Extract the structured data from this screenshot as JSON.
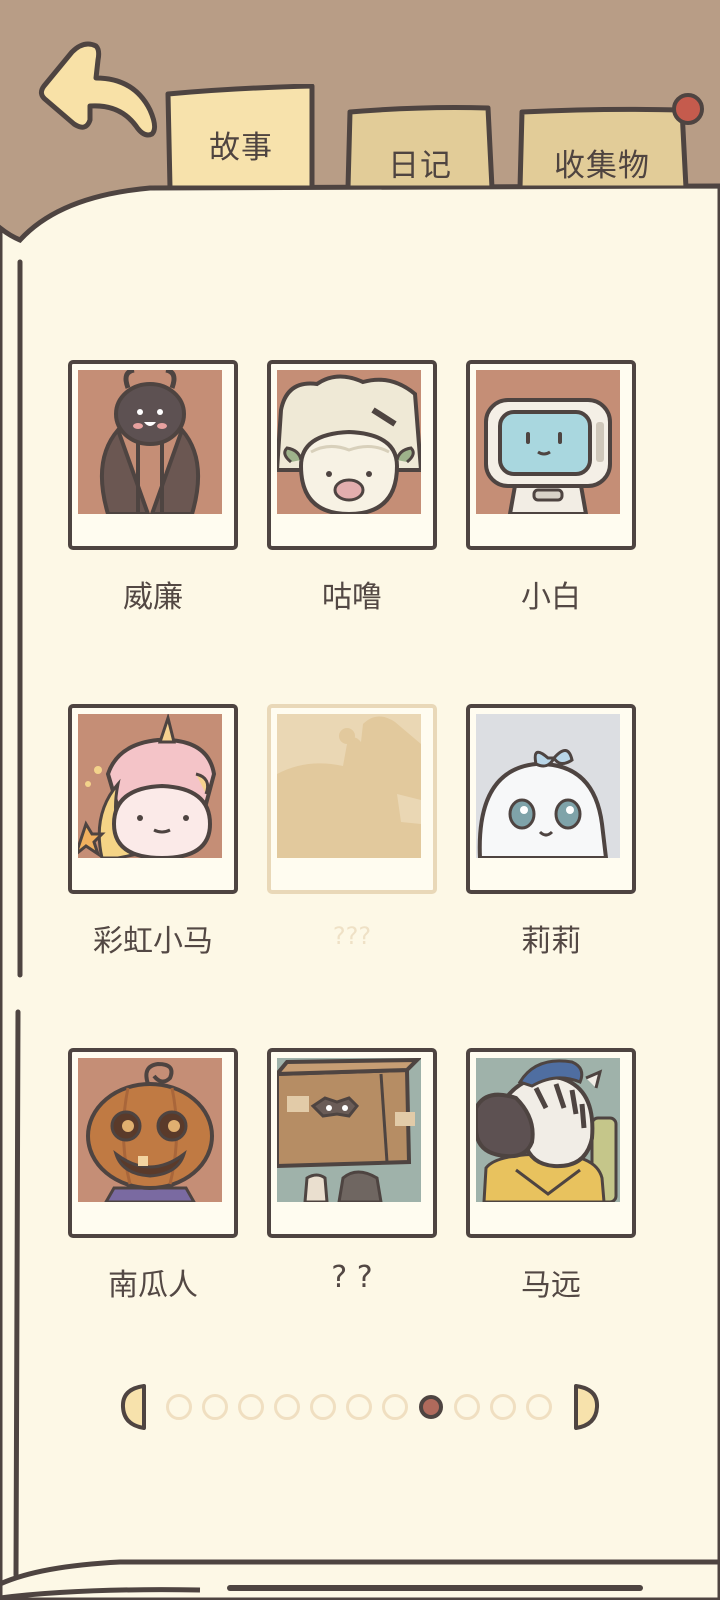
{
  "header": {
    "back_button": "back-arrow-icon",
    "tabs": [
      {
        "label": "故事",
        "active": true
      },
      {
        "label": "日记",
        "active": false
      },
      {
        "label": "收集物",
        "active": false,
        "has_notification": true
      }
    ]
  },
  "characters": [
    {
      "name": "威廉",
      "unlocked": true,
      "art": "beetle-character",
      "bg_color": "#c58e76"
    },
    {
      "name": "咕噜",
      "unlocked": true,
      "art": "sheep-pig-character",
      "bg_color": "#c58e76"
    },
    {
      "name": "小白",
      "unlocked": true,
      "art": "robot-character",
      "bg_color": "#c58e76"
    },
    {
      "name": "彩虹小马",
      "unlocked": true,
      "art": "unicorn-character",
      "bg_color": "#c58e76"
    },
    {
      "name": "???",
      "unlocked": false,
      "art": "locked-silhouette",
      "bg_color": "#ead7b4"
    },
    {
      "name": "莉莉",
      "unlocked": true,
      "art": "ghost-character",
      "bg_color": "#dcdee2"
    },
    {
      "name": "南瓜人",
      "unlocked": true,
      "art": "pumpkin-character",
      "bg_color": "#c58e76"
    },
    {
      "name": "? ?",
      "unlocked": true,
      "art": "box-character",
      "bg_color": "#9fb2aa"
    },
    {
      "name": "马远",
      "unlocked": true,
      "art": "zebra-character",
      "bg_color": "#9fb2aa"
    }
  ],
  "pagination": {
    "total_pages": 11,
    "current_page": 8,
    "prev_icon": "half-moon-left-icon",
    "next_icon": "half-moon-right-icon"
  },
  "colors": {
    "outline": "#4e4441",
    "page_bg": "#fdf8e6",
    "header_bg": "#b89d86",
    "active_tab": "#f7e2ac",
    "inactive_tab": "#e2cc98",
    "notification": "#c55b4d",
    "active_dot": "#b06a5c"
  }
}
